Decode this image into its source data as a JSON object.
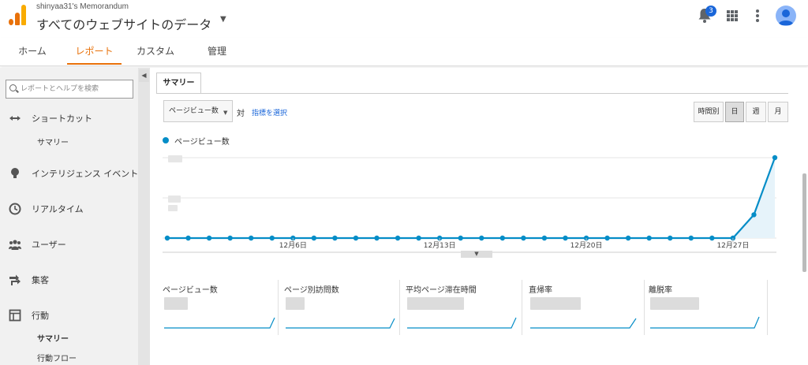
{
  "header": {
    "account": "shinyaa31's Memorandum",
    "property": "すべてのウェブサイトのデータ",
    "notification_count": "3",
    "icons": [
      "analytics-logo-icon",
      "chevron-down-icon",
      "bell-icon",
      "apps-grid-icon",
      "more-vert-icon",
      "avatar-icon"
    ]
  },
  "nav": {
    "tabs": [
      {
        "label": "ホーム"
      },
      {
        "label": "レポート"
      },
      {
        "label": "カスタム"
      },
      {
        "label": "管理"
      }
    ],
    "active_tab": "レポート"
  },
  "sidebar": {
    "search_placeholder": "レポートとヘルプを検索",
    "items": [
      {
        "label": "ショートカット",
        "icon": "shortcut-arrows-icon"
      },
      {
        "label": "サマリー"
      },
      {
        "label": "インテリジェンス イベント",
        "icon": "lightbulb-icon"
      },
      {
        "label": "リアルタイム",
        "icon": "clock-icon"
      },
      {
        "label": "ユーザー",
        "icon": "people-icon"
      },
      {
        "label": "集客",
        "icon": "acquisition-arrows-icon"
      },
      {
        "label": "行動",
        "icon": "behavior-window-icon"
      },
      {
        "label": "サマリー"
      },
      {
        "label": "行動フロー"
      }
    ]
  },
  "main": {
    "tab_label": "サマリー",
    "metric_select": "ページビュー数",
    "vs_label": "対",
    "choose_metric": "指標を選択",
    "period_buttons": [
      "時間別",
      "日",
      "週",
      "月"
    ],
    "active_period": "日",
    "legend_label": "ページビュー数"
  },
  "colors": {
    "accent": "#e8710a",
    "series": "#058dc7",
    "link": "#1a66d9"
  },
  "chart_data": {
    "type": "line",
    "x_tick_labels": [
      "12月6日",
      "12月13日",
      "12月20日",
      "12月27日"
    ],
    "y_scale": "relative (tick labels blurred)",
    "series": [
      {
        "name": "ページビュー数",
        "values": [
          0,
          0,
          0,
          0,
          0,
          0,
          0,
          0,
          0,
          0,
          0,
          0,
          0,
          0,
          0,
          0,
          0,
          0,
          0,
          0,
          0,
          0,
          0,
          0,
          0,
          0,
          0,
          0,
          0.29,
          1.0
        ]
      }
    ],
    "grid": true,
    "legend": "top-left"
  },
  "scorecards": [
    {
      "label": "ページビュー数"
    },
    {
      "label": "ページ別訪問数"
    },
    {
      "label": "平均ページ滞在時間"
    },
    {
      "label": "直帰率"
    },
    {
      "label": "離脱率"
    }
  ]
}
